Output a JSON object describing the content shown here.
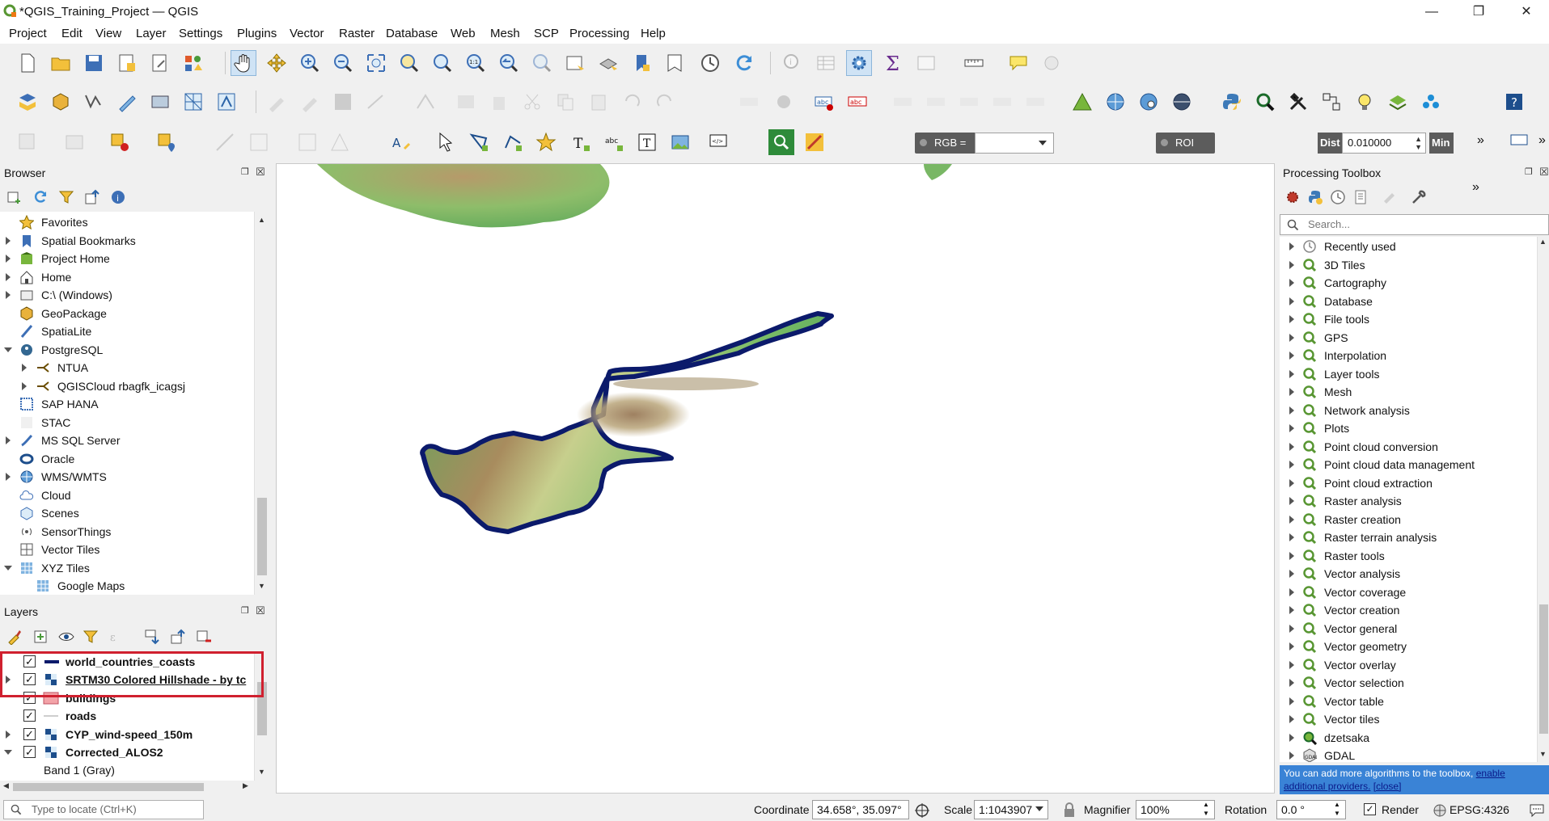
{
  "window": {
    "title": "*QGIS_Training_Project — QGIS"
  },
  "menu": [
    "Project",
    "Edit",
    "View",
    "Layer",
    "Settings",
    "Plugins",
    "Vector",
    "Raster",
    "Database",
    "Web",
    "Mesh",
    "SCP",
    "Processing",
    "Help"
  ],
  "toolbar3": {
    "rgb_label": "RGB =",
    "roi_label": "ROI",
    "dist_label": "Dist",
    "dist_value": "0.010000",
    "min_label": "Min"
  },
  "browser": {
    "title": "Browser",
    "items": [
      {
        "label": "Favorites",
        "icon": "star-icon"
      },
      {
        "label": "Spatial Bookmarks",
        "icon": "bookmark-icon"
      },
      {
        "label": "Project Home",
        "icon": "project-home-icon"
      },
      {
        "label": "Home",
        "icon": "home-icon"
      },
      {
        "label": "C:\\ (Windows)",
        "icon": "drive-icon"
      },
      {
        "label": "GeoPackage",
        "icon": "geopackage-icon"
      },
      {
        "label": "SpatiaLite",
        "icon": "spatialite-icon"
      },
      {
        "label": "PostgreSQL",
        "icon": "postgresql-icon"
      },
      {
        "label": "NTUA",
        "icon": "connection-icon"
      },
      {
        "label": "QGISCloud rbagfk_icagsj",
        "icon": "connection-icon"
      },
      {
        "label": "SAP HANA",
        "icon": "sap-hana-icon"
      },
      {
        "label": "STAC",
        "icon": "stac-icon"
      },
      {
        "label": "MS SQL Server",
        "icon": "mssql-icon"
      },
      {
        "label": "Oracle",
        "icon": "oracle-icon"
      },
      {
        "label": "WMS/WMTS",
        "icon": "wms-icon"
      },
      {
        "label": "Cloud",
        "icon": "cloud-icon"
      },
      {
        "label": "Scenes",
        "icon": "scenes-icon"
      },
      {
        "label": "SensorThings",
        "icon": "sensorthings-icon"
      },
      {
        "label": "Vector Tiles",
        "icon": "vector-tiles-icon"
      },
      {
        "label": "XYZ Tiles",
        "icon": "xyz-tiles-icon"
      },
      {
        "label": "Google Maps",
        "icon": "xyz-tiles-icon"
      }
    ]
  },
  "layers": {
    "title": "Layers",
    "items": [
      {
        "label": "world_countries_coasts",
        "checked": true
      },
      {
        "label": "SRTM30 Colored Hillshade - by tc",
        "checked": true
      },
      {
        "label": "buildings",
        "checked": true
      },
      {
        "label": "roads",
        "checked": true
      },
      {
        "label": "CYP_wind-speed_150m",
        "checked": true
      },
      {
        "label": "Corrected_ALOS2",
        "checked": true
      },
      {
        "label": "Band 1 (Gray)",
        "checked": false
      }
    ],
    "highlight_color": "#d0202f"
  },
  "toolbox": {
    "title": "Processing Toolbox",
    "search_placeholder": "Search...",
    "items": [
      "Recently used",
      "3D Tiles",
      "Cartography",
      "Database",
      "File tools",
      "GPS",
      "Interpolation",
      "Layer tools",
      "Mesh",
      "Network analysis",
      "Plots",
      "Point cloud conversion",
      "Point cloud data management",
      "Point cloud extraction",
      "Raster analysis",
      "Raster creation",
      "Raster terrain analysis",
      "Raster tools",
      "Vector analysis",
      "Vector coverage",
      "Vector creation",
      "Vector general",
      "Vector geometry",
      "Vector overlay",
      "Vector selection",
      "Vector table",
      "Vector tiles",
      "dzetsaka",
      "GDAL"
    ],
    "info_text": "You can add more algorithms to the toolbox,",
    "info_link": "enable additional providers.",
    "info_close": "[close]"
  },
  "status": {
    "locate_placeholder": "Type to locate (Ctrl+K)",
    "coordinate_label": "Coordinate",
    "coordinate_value": "34.658°, 35.097°",
    "scale_label": "Scale",
    "scale_value": "1:1043907",
    "magnifier_label": "Magnifier",
    "magnifier_value": "100%",
    "rotation_label": "Rotation",
    "rotation_value": "0.0 °",
    "render_label": "Render",
    "crs_label": "EPSG:4326"
  },
  "colors": {
    "coast": "#0b1a6b",
    "land_low": "#4fa45a",
    "land_mid": "#a7c77e",
    "land_high": "#9a7550"
  }
}
